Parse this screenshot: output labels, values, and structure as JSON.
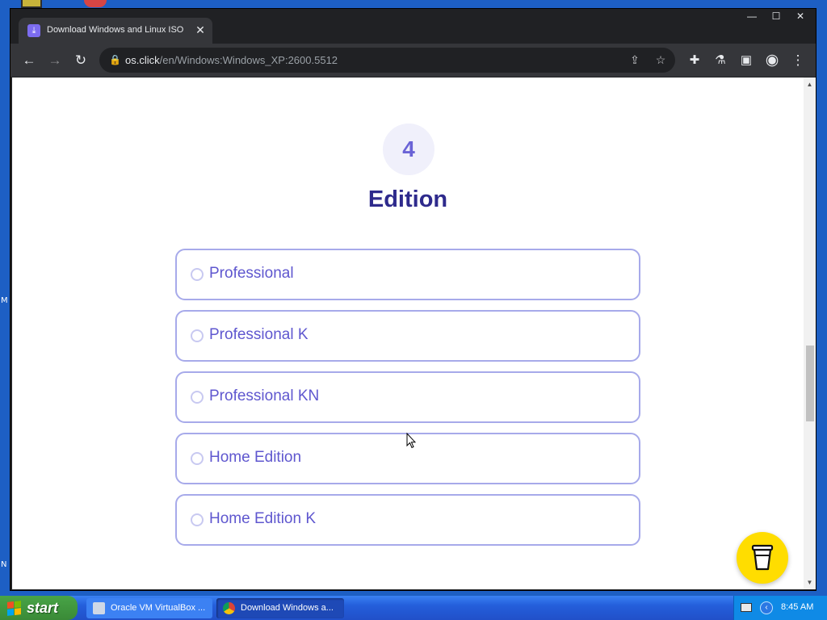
{
  "browser": {
    "tab_title": "Download Windows and Linux ISO f",
    "tab_close_glyph": "✕",
    "window_controls": [
      "—",
      "☐",
      "✕"
    ],
    "url_host": "os.click",
    "url_path": "/en/Windows:Windows_XP:2600.5512"
  },
  "page": {
    "step_number": "4",
    "heading": "Edition",
    "options": [
      {
        "label": "Professional"
      },
      {
        "label": "Professional K"
      },
      {
        "label": "Professional KN"
      },
      {
        "label": "Home Edition"
      },
      {
        "label": "Home Edition K"
      }
    ]
  },
  "desktop": {
    "edge_letters": [
      "M",
      "N"
    ]
  },
  "taskbar": {
    "start_label": "start",
    "tasks": [
      {
        "label": "Oracle VM VirtualBox ...",
        "icon": "virtualbox-icon"
      },
      {
        "label": "Download Windows a...",
        "icon": "chrome-icon"
      }
    ],
    "clock": "8:45 AM"
  },
  "colors": {
    "accent": "#5f57cf",
    "heading": "#2e2a8c",
    "option_border": "#a7aaea",
    "coffee_button": "#ffdd00",
    "taskbar_blue": "#245edb",
    "start_green": "#3a8a37"
  }
}
